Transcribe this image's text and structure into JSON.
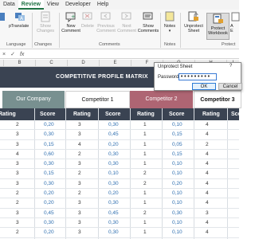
{
  "ribbon_tabs": [
    "Data",
    "Review",
    "View",
    "Developer",
    "Help"
  ],
  "active_tab": "Review",
  "ribbon": {
    "buttons": {
      "partial_left": "p",
      "translate": "Translate",
      "show_changes": "Show\nChanges",
      "new_comment": "New\nComment",
      "delete": "Delete",
      "previous_comment": "Previous\nComment",
      "next_comment": "Next\nComment",
      "show_comments": "Show\nComments",
      "notes": "Notes",
      "unprotect_sheet": "Unprotect\nSheet",
      "protect_workbook": "Protect\nWorkbook",
      "partial_right": "A\nE"
    },
    "groups": {
      "language": "Language",
      "changes": "Changes",
      "comments": "Comments",
      "notes": "Notes",
      "protect": "Protect"
    }
  },
  "formula_bar": {
    "cancel": "×",
    "enter": "✓",
    "function": "fx"
  },
  "columns": [
    "B",
    "C",
    "D",
    "E",
    "F",
    "G",
    "H",
    "I"
  ],
  "sheet": {
    "title": "COMPETITIVE PROFILE MATRIX",
    "competitors": [
      "Our Company",
      "Competitor 1",
      "Competitor 2",
      "Competitor 3"
    ],
    "header_labels": {
      "rating": "Rating",
      "score": "Score"
    },
    "rows": [
      [
        "2",
        "0,20",
        "3",
        "0,30",
        "1",
        "0,10",
        "4"
      ],
      [
        "3",
        "0,30",
        "3",
        "0,45",
        "1",
        "0,15",
        "4"
      ],
      [
        "3",
        "0,15",
        "4",
        "0,20",
        "1",
        "0,05",
        "2"
      ],
      [
        "4",
        "0,60",
        "2",
        "0,30",
        "1",
        "0,15",
        "4"
      ],
      [
        "3",
        "0,30",
        "3",
        "0,30",
        "1",
        "0,10",
        "4"
      ],
      [
        "3",
        "0,15",
        "2",
        "0,10",
        "2",
        "0,10",
        "4"
      ],
      [
        "3",
        "0,30",
        "3",
        "0,30",
        "2",
        "0,20",
        "4"
      ],
      [
        "2",
        "0,20",
        "2",
        "0,20",
        "1",
        "0,10",
        "4"
      ],
      [
        "2",
        "0,20",
        "3",
        "0,30",
        "1",
        "0,10",
        "4"
      ],
      [
        "3",
        "0,45",
        "3",
        "0,45",
        "2",
        "0,30",
        "3"
      ],
      [
        "3",
        "0,30",
        "3",
        "0,30",
        "1",
        "0,10",
        "4"
      ],
      [
        "2",
        "0,20",
        "3",
        "0,30",
        "1",
        "0,10",
        "4"
      ]
    ]
  },
  "dialog": {
    "title": "Unprotect Sheet",
    "help": "?",
    "password_label": "Password:",
    "password_value": "•••••••••",
    "ok_label": "OK",
    "cancel_label": "Cancel"
  },
  "colors": {
    "header_dark": "#3a4352",
    "our_company": "#789090",
    "competitor_2": "#ae6573",
    "score_text": "#2f6fb0",
    "excel_green": "#217346"
  }
}
